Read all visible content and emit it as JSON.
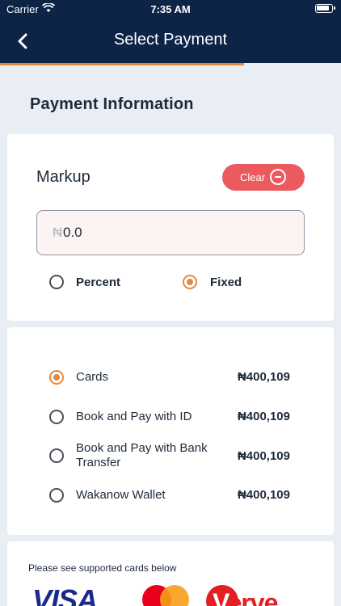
{
  "status_bar": {
    "carrier": "Carrier",
    "time": "7:35 AM"
  },
  "header": {
    "title": "Select Payment"
  },
  "section_title": "Payment Information",
  "markup": {
    "label": "Markup",
    "clear_label": "Clear",
    "currency_symbol": "₦",
    "value": "0.0",
    "options": [
      {
        "label": "Percent",
        "selected": false
      },
      {
        "label": "Fixed",
        "selected": true
      }
    ]
  },
  "payment_methods": [
    {
      "name": "Cards",
      "amount": "₦400,109",
      "selected": true
    },
    {
      "name": "Book and Pay with ID",
      "amount": "₦400,109",
      "selected": false
    },
    {
      "name": "Book and Pay with Bank Transfer",
      "amount": "₦400,109",
      "selected": false
    },
    {
      "name": "Wakanow Wallet",
      "amount": "₦400,109",
      "selected": false
    }
  ],
  "supported_cards": {
    "note": "Please see supported cards below",
    "brands": [
      "VISA",
      "mastercard",
      "Verve"
    ]
  },
  "colors": {
    "header_bg": "#0d2447",
    "accent": "#e8873a",
    "clear_button": "#ea5a5e",
    "background": "#e9eef4"
  }
}
